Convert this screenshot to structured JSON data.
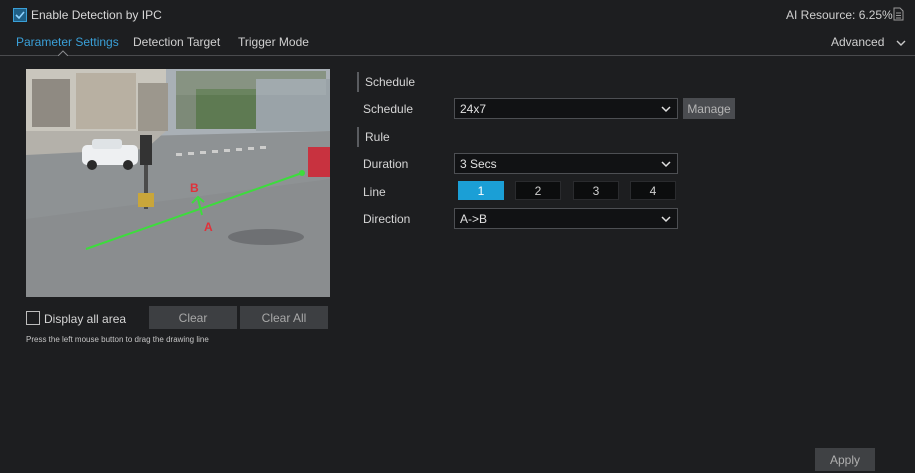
{
  "header": {
    "enable_label": "Enable Detection by IPC",
    "enable_checked": true,
    "ai_resource_label": "AI Resource: 6.25%"
  },
  "tabs": [
    {
      "label": "Parameter Settings",
      "active": true
    },
    {
      "label": "Detection Target",
      "active": false
    },
    {
      "label": "Trigger Mode",
      "active": false
    }
  ],
  "advanced_label": "Advanced",
  "preview": {
    "label_a": "A",
    "label_b": "B"
  },
  "area_controls": {
    "display_all_label": "Display all area",
    "display_all_checked": false,
    "clear_label": "Clear",
    "clear_all_label": "Clear All",
    "hint": "Press the left mouse button to drag the drawing line"
  },
  "schedule": {
    "section_title": "Schedule",
    "label": "Schedule",
    "value": "24x7",
    "manage_label": "Manage"
  },
  "rule": {
    "section_title": "Rule",
    "duration_label": "Duration",
    "duration_value": "3 Secs",
    "line_label": "Line",
    "line_options": [
      "1",
      "2",
      "3",
      "4"
    ],
    "line_selected": "1",
    "direction_label": "Direction",
    "direction_value": "A->B"
  },
  "apply_label": "Apply",
  "colors": {
    "accent": "#3aa0d8",
    "line_active": "#1b9fd6",
    "draw_line": "#3ddc3d",
    "marker": "#e0313a"
  }
}
